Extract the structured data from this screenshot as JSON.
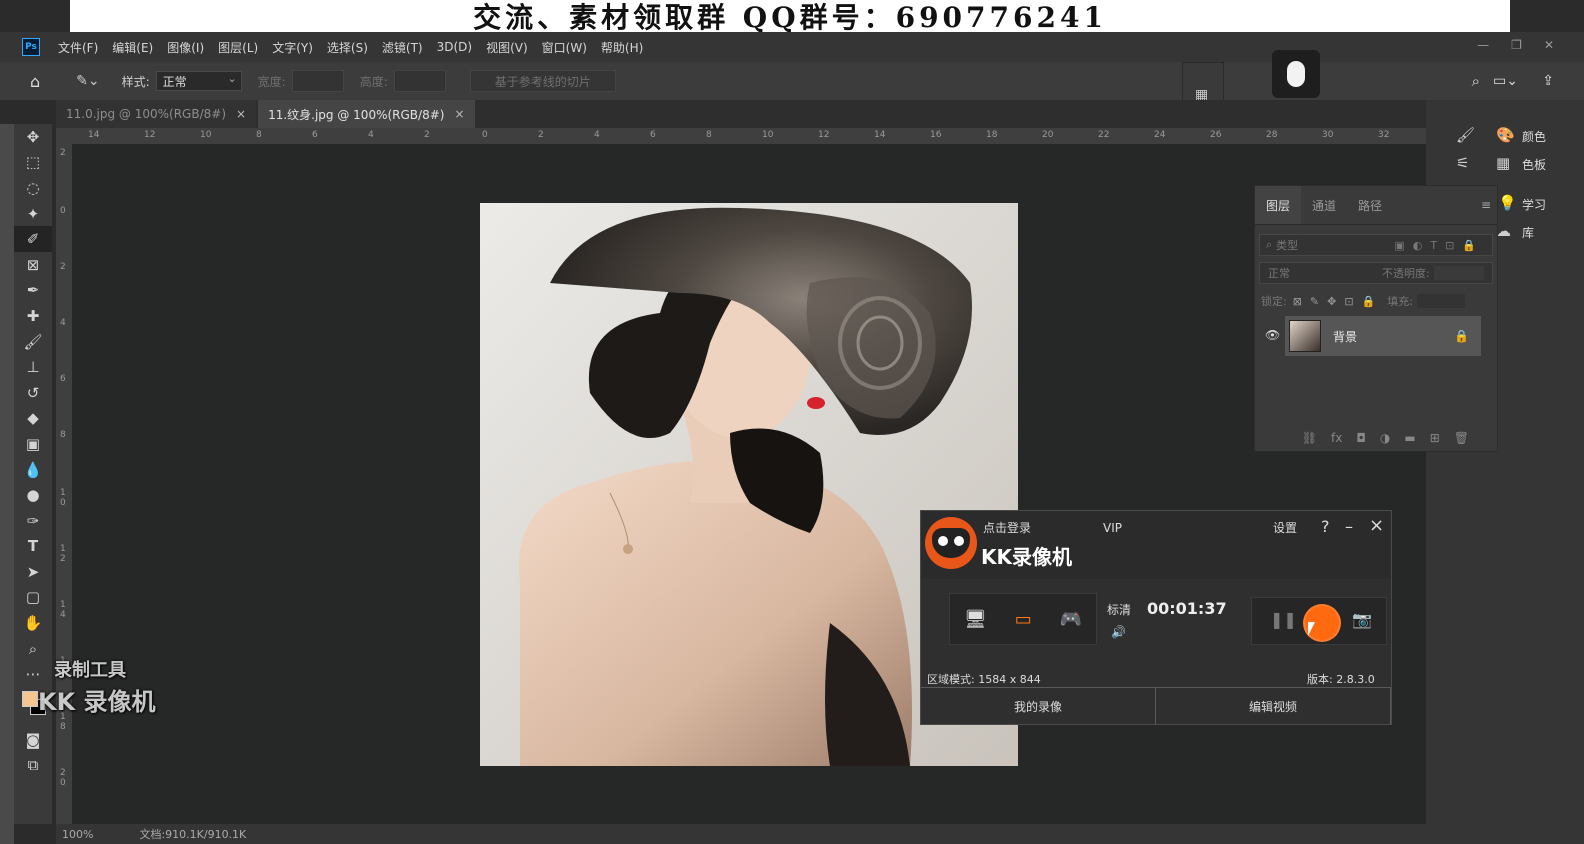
{
  "banner": {
    "text": "交流、素材领取群 QQ群号：690776241"
  },
  "menubar": {
    "app_icon": "Ps",
    "items": [
      "文件(F)",
      "编辑(E)",
      "图像(I)",
      "图层(L)",
      "文字(Y)",
      "选择(S)",
      "滤镜(T)",
      "3D(D)",
      "视图(V)",
      "窗口(W)",
      "帮助(H)"
    ]
  },
  "options": {
    "style_label": "样式:",
    "style_value": "正常",
    "width_label": "宽度:",
    "height_label": "高度:",
    "slices_btn": "基于参考线的切片"
  },
  "tabs": [
    {
      "label": "11.0.jpg @ 100%(RGB/8#)",
      "close": "×"
    },
    {
      "label": "11.纹身.jpg @ 100%(RGB/8#)",
      "close": "×"
    }
  ],
  "ruler": {
    "h": [
      "14",
      "12",
      "10",
      "8",
      "6",
      "4",
      "2",
      "0",
      "2",
      "4",
      "6",
      "8",
      "10",
      "12",
      "14",
      "16",
      "18",
      "20",
      "22",
      "24",
      "26",
      "28",
      "30",
      "32"
    ],
    "v": [
      "2",
      "0",
      "2",
      "4",
      "6",
      "8",
      "1 0",
      "1 2",
      "1 4",
      "1 6",
      "1 8",
      "2 0"
    ]
  },
  "right_panels": {
    "color_label": "颜色",
    "swatches_label": "色板",
    "learn_label": "学习",
    "library_label": "库"
  },
  "layers_panel": {
    "tabs": [
      "图层",
      "通道",
      "路径"
    ],
    "search_placeholder": "类型",
    "blend_mode": "正常",
    "opacity_label": "不透明度:",
    "lock_label": "锁定:",
    "fill_label": "填充:",
    "layer_name": "背景"
  },
  "recorder": {
    "login": "点击登录",
    "vip": "VIP",
    "settings": "设置",
    "help": "?",
    "minimize": "–",
    "close": "×",
    "brand": "KK录像机",
    "quality": "标清",
    "timer": "00:01:37",
    "mode": "区域模式: 1584 x 844",
    "version": "版本: 2.8.3.0",
    "my_recordings": "我的录像",
    "edit_video": "编辑视频"
  },
  "watermark": {
    "line1": "录制工具",
    "line2": "KK 录像机"
  },
  "status": {
    "zoom": "100%",
    "doc": "文档:910.1K/910.1K"
  },
  "colors": {
    "recorder_accent": "#ff6a10",
    "foreground": "#f7c58f",
    "background": "#000000"
  }
}
